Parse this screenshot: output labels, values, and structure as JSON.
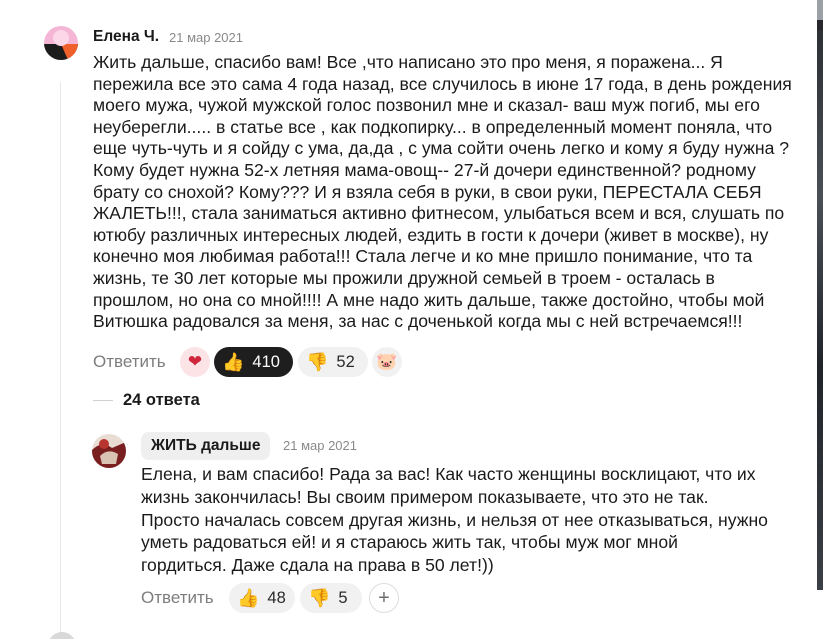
{
  "comment": {
    "author": "Елена Ч.",
    "date": "21 мар 2021",
    "text_lines": [
      "Жить дальше, спасибо вам! Все ,что написано это про меня, я поражена... Я",
      "пережила все это сама 4 года назад, все случилось в июне 17 года, в день рождения",
      "моего мужа, чужой мужской голос позвонил мне и сказал- ваш муж погиб, мы его",
      "неуберегли..... в статье все , как подкопирку... в определенный момент поняла, что",
      "еще чуть-чуть и я сойду с ума, да,да , с ума сойти очень легко и кому я буду нужна ?",
      "Кому будет нужна 52-х летняя мама-овощ-- 27-й дочери единственной? родному",
      "брату со снохой? Кому??? И я взяла себя в руки, в свои руки, ПЕРЕСТАЛА СЕБЯ",
      "ЖАЛЕТЬ!!!, стала заниматься активно фитнесом, улыбаться всем и вся, слушать по",
      "ютюбу различных интересных людей, ездить в гости к дочери (живет в москве), ну",
      "конечно моя любимая работа!!! Стала легче и ко мне пришло понимание, что та",
      "жизнь, те 30 лет которые мы прожили дружной семьей в троем - осталась в",
      "прошлом, но она со мной!!!! А мне надо жить дальше, также достойно, чтобы мой",
      "Витюшка радовался за меня, за нас с доченькой когда мы с ней встречаемся!!!"
    ],
    "reply_label": "Ответить",
    "reactions": {
      "likes": "410",
      "dislikes": "52"
    }
  },
  "replies_count": "24 ответа",
  "reply": {
    "author": "ЖИТЬ дальше",
    "date": "21 мар 2021",
    "text_lines": [
      "Елена, и вам спасибо! Рада за вас! Как часто женщины восклицают, что их",
      "жизнь закончилась! Вы своим примером показываете, что это не так.",
      "Просто началась совсем другая жизнь, и нельзя от нее отказываться, нужно",
      "уметь радоваться ей! и я стараюсь жить так, чтобы муж мог мной",
      "гордиться. Даже сдала на права в 50 лет!))"
    ],
    "reply_label": "Ответить",
    "reactions": {
      "likes": "48",
      "dislikes": "5"
    }
  },
  "icons": {
    "thumbs_up": "👍",
    "thumbs_down": "👎",
    "heart_face": "❤",
    "pig": "🐷",
    "plus": "+"
  }
}
